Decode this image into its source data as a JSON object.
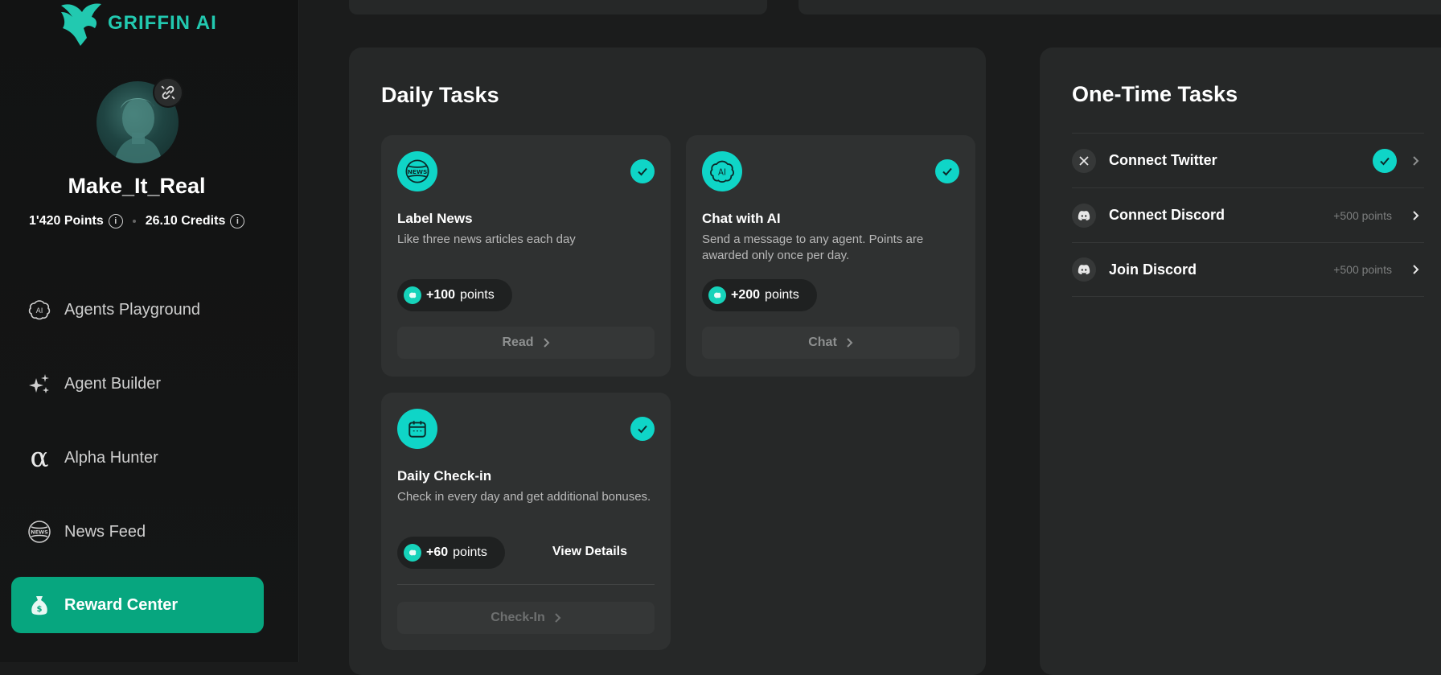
{
  "brand": {
    "name": "GRIFFIN AI"
  },
  "profile": {
    "username": "Make_It_Real",
    "points": "1'420 Points",
    "credits": "26.10 Credits"
  },
  "nav": [
    {
      "label": "Agents Playground",
      "icon": "ai-brain-icon"
    },
    {
      "label": "Agent Builder",
      "icon": "sparkles-icon"
    },
    {
      "label": "Alpha Hunter",
      "icon": "alpha-icon"
    },
    {
      "label": "News Feed",
      "icon": "news-globe-icon"
    },
    {
      "label": "Reward Center",
      "icon": "money-bag-icon",
      "active": true
    }
  ],
  "daily": {
    "title": "Daily Tasks",
    "tasks": [
      {
        "title": "Label News",
        "desc": "Like three news articles each day",
        "points": "+100",
        "points_unit": "points",
        "button": "Read",
        "completed": true,
        "icon": "news-icon"
      },
      {
        "title": "Chat with AI",
        "desc": "Send a message to any agent. Points are awarded only once per day.",
        "points": "+200",
        "points_unit": "points",
        "button": "Chat",
        "completed": true,
        "icon": "ai-brain-icon"
      },
      {
        "title": "Daily Check-in",
        "desc": "Check in every day and get additional bonuses.",
        "points": "+60",
        "points_unit": "points",
        "button": "Check-In",
        "details": "View Details",
        "completed": true,
        "icon": "calendar-icon"
      }
    ]
  },
  "onetime": {
    "title": "One-Time Tasks",
    "tasks": [
      {
        "label": "Connect Twitter",
        "completed": true,
        "icon": "x-icon"
      },
      {
        "label": "Connect Discord",
        "reward": "+500 points",
        "completed": false,
        "icon": "discord-icon"
      },
      {
        "label": "Join Discord",
        "reward": "+500 points",
        "completed": false,
        "icon": "discord-icon"
      }
    ]
  },
  "colors": {
    "accent": "#0fd5c7",
    "active_nav": "#07a67f",
    "brand": "#22c9b0"
  }
}
